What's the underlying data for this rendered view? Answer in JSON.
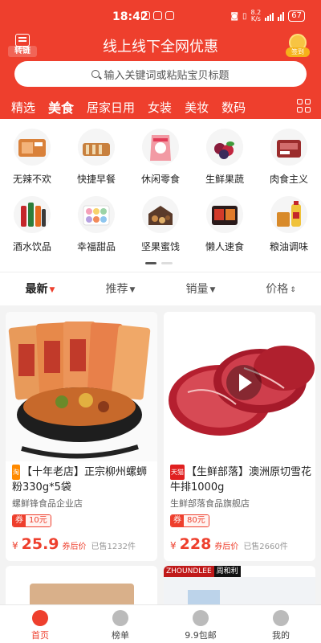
{
  "status": {
    "time": "18:42",
    "speed_top": "8.2",
    "speed_bottom": "K/s",
    "battery": "67"
  },
  "header": {
    "title": "线上线下全网优惠",
    "transfer_label": "转链",
    "signin_label": "签到"
  },
  "search": {
    "placeholder": "输入关键词或粘贴宝贝标题"
  },
  "categories": [
    "精选",
    "美食",
    "居家日用",
    "女装",
    "美妆",
    "数码"
  ],
  "subcategories": [
    {
      "label": "无辣不欢",
      "icon": "spicy-snack-icon"
    },
    {
      "label": "快捷早餐",
      "icon": "bread-icon"
    },
    {
      "label": "休闲零食",
      "icon": "snack-bag-icon"
    },
    {
      "label": "生鲜果蔬",
      "icon": "fruit-icon"
    },
    {
      "label": "肉食主义",
      "icon": "meat-icon"
    },
    {
      "label": "酒水饮品",
      "icon": "drinks-icon"
    },
    {
      "label": "幸福甜品",
      "icon": "macaron-icon"
    },
    {
      "label": "坚果蜜饯",
      "icon": "nuts-icon"
    },
    {
      "label": "懒人速食",
      "icon": "instant-food-icon"
    },
    {
      "label": "粮油调味",
      "icon": "oil-icon"
    }
  ],
  "sort": [
    "最新",
    "推荐",
    "销量",
    "价格"
  ],
  "products": [
    {
      "name": "【十年老店】正宗柳州螺蛳粉330g*5袋",
      "shop": "螺鲜锋食品企业店",
      "coupon_label": "券",
      "coupon": "10元",
      "currency": "¥",
      "price": "25.9",
      "price_note": "券后价",
      "sold": "已售1232件"
    },
    {
      "name": "【生鲜部落】澳洲原切雪花牛排1000g",
      "shop": "生鲜部落食品旗舰店",
      "coupon_label": "券",
      "coupon": "80元",
      "currency": "¥",
      "price": "228",
      "price_note": "券后价",
      "sold": "已售2660件"
    }
  ],
  "partial_card": {
    "brand": "ZHOUNDLEE",
    "brand2": "周和利"
  },
  "tabs": [
    "首页",
    "榜单",
    "9.9包邮",
    "我的"
  ],
  "colors": {
    "accent": "#ee3f2d"
  }
}
